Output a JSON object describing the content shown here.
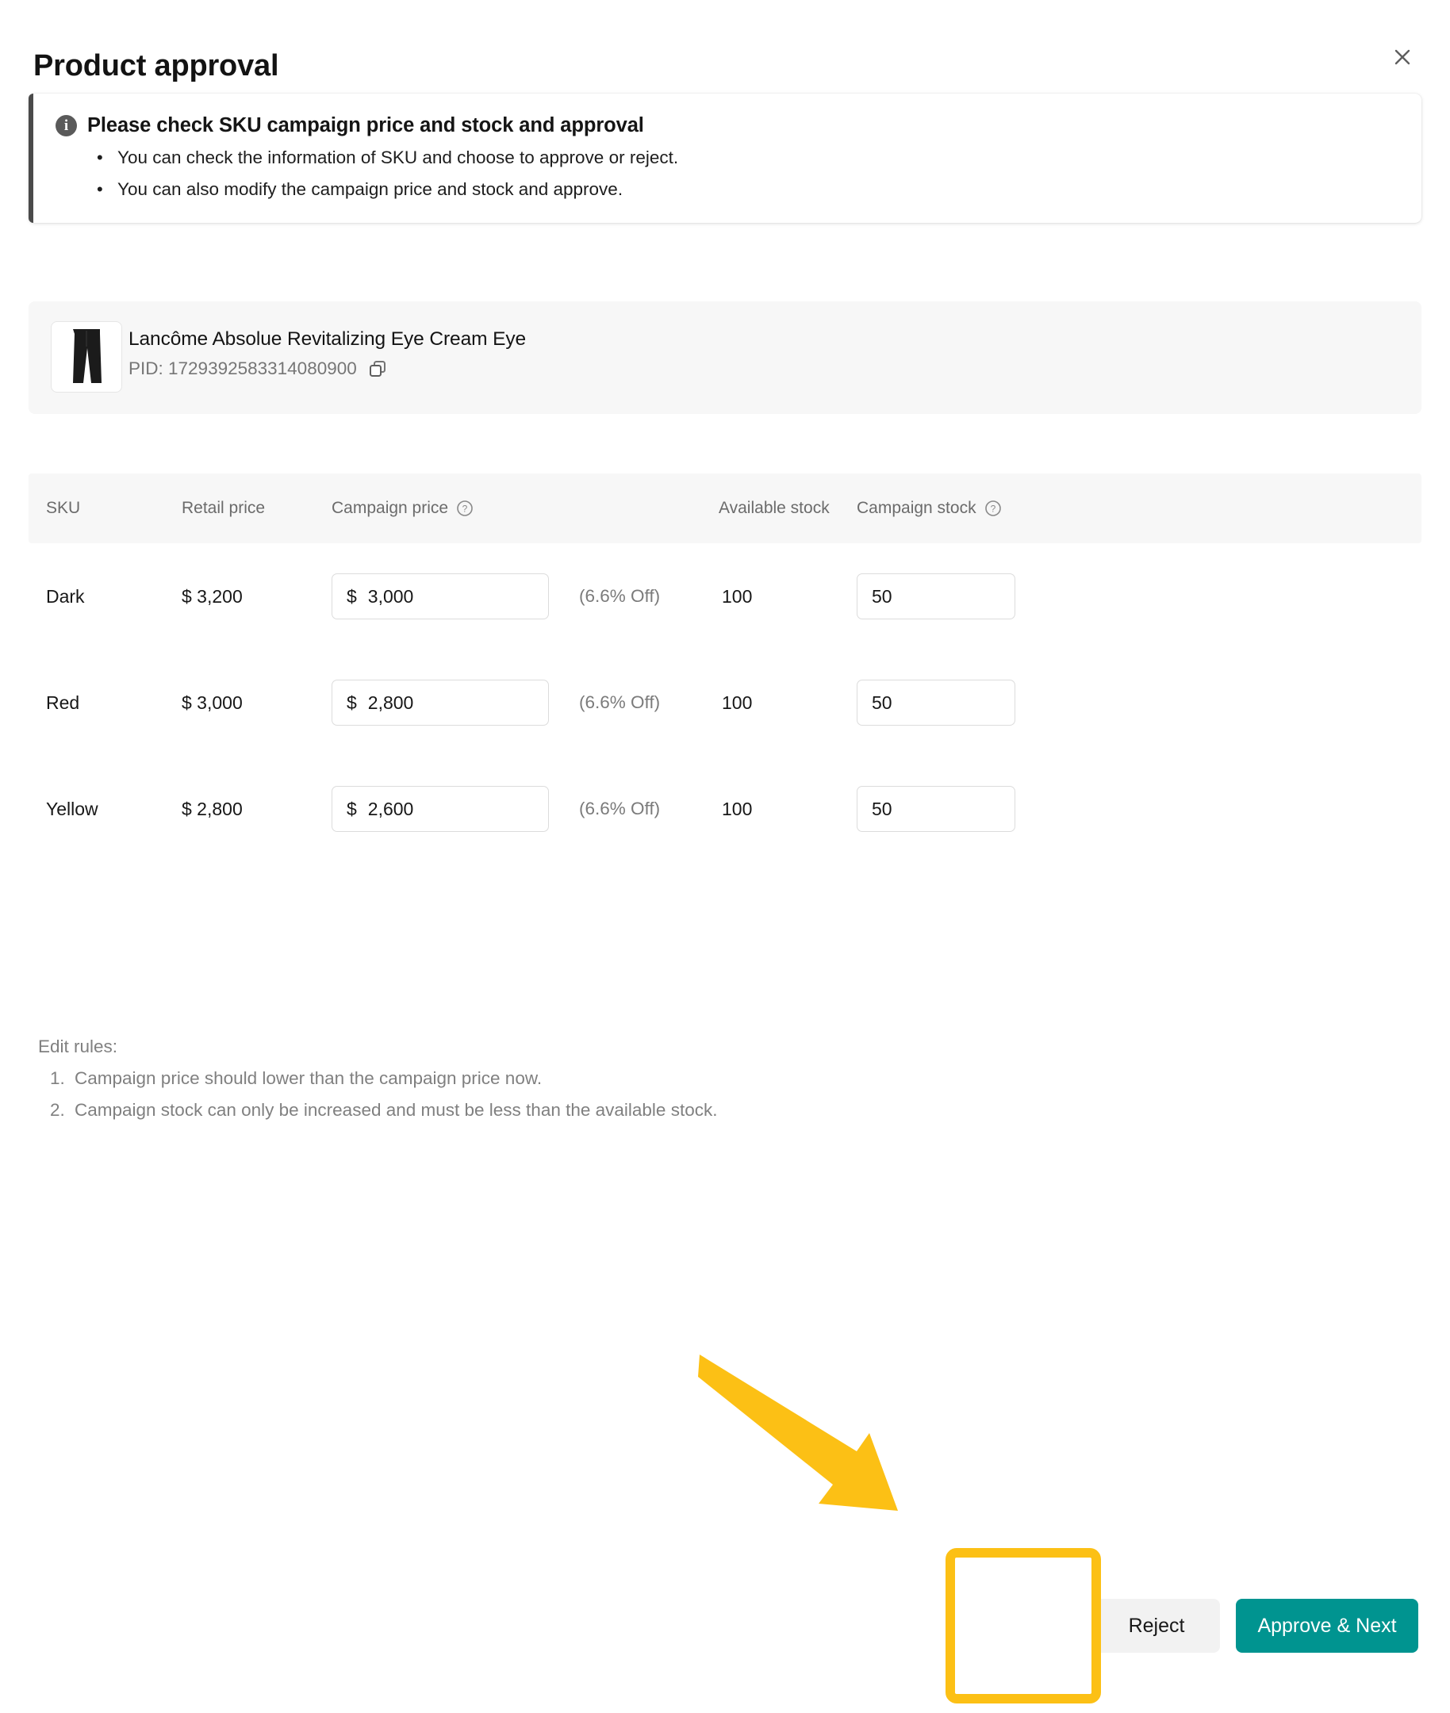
{
  "header": {
    "title": "Product approval",
    "close_icon": "close-icon"
  },
  "info_banner": {
    "icon": "info-icon",
    "title": "Please check SKU campaign price and stock and approval",
    "bullets": [
      "You can check the information of SKU and choose to approve or reject.",
      "You can also modify the campaign price and stock and approve."
    ]
  },
  "product": {
    "thumbnail_icon": "product-image-black-pants",
    "name": "Lancôme Absolue Revitalizing Eye Cream Eye",
    "pid_label": "PID: 1729392583314080900",
    "copy_icon": "copy-icon"
  },
  "table": {
    "columns": {
      "sku": "SKU",
      "retail_price": "Retail price",
      "campaign_price": "Campaign price",
      "available_stock": "Available stock",
      "campaign_stock": "Campaign stock"
    },
    "help_icon": "question-mark-icon",
    "currency_symbol": "$",
    "rows": [
      {
        "sku": "Dark",
        "retail_price": "$ 3,200",
        "campaign_price": "3,000",
        "discount": "(6.6% Off)",
        "available_stock": "100",
        "campaign_stock": "50"
      },
      {
        "sku": "Red",
        "retail_price": "$ 3,000",
        "campaign_price": "2,800",
        "discount": "(6.6% Off)",
        "available_stock": "100",
        "campaign_stock": "50"
      },
      {
        "sku": "Yellow",
        "retail_price": "$ 2,800",
        "campaign_price": "2,600",
        "discount": "(6.6% Off)",
        "available_stock": "100",
        "campaign_stock": "50"
      }
    ]
  },
  "edit_rules": {
    "title": "Edit rules:",
    "items": [
      "Campaign price should lower than the campaign price now.",
      "Campaign stock can only be increased and must be less than the available stock."
    ]
  },
  "footer": {
    "reject_label": "Reject",
    "approve_label": "Approve & Next"
  },
  "annotations": {
    "arrow_color": "#fcc015",
    "highlight_color": "#fcc015",
    "target": "reject-button"
  },
  "colors": {
    "accent_teal": "#009490",
    "banner_bar": "#4a4a4a",
    "muted_text": "#808080",
    "card_bg": "#f7f7f7"
  }
}
